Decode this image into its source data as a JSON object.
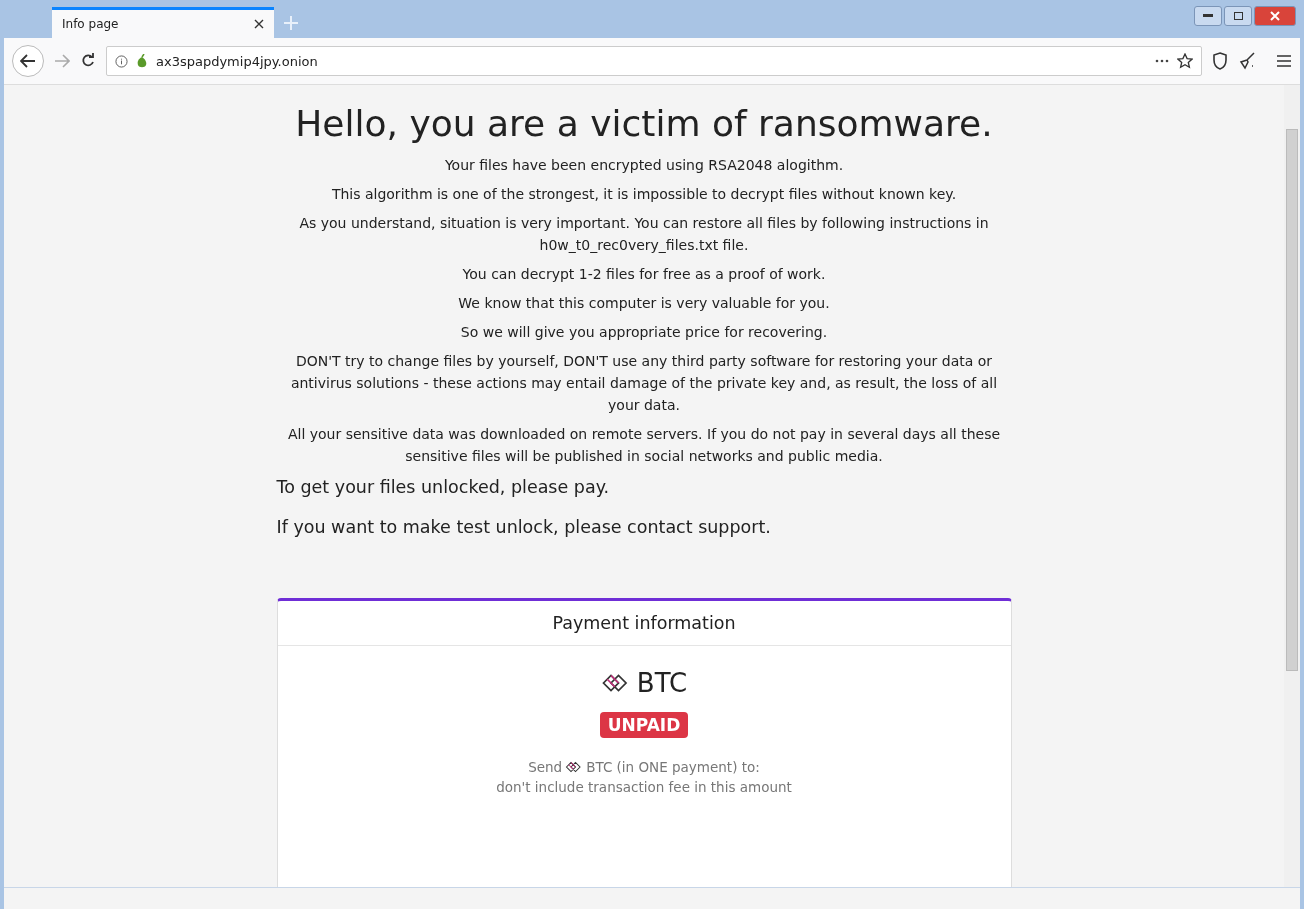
{
  "tabs": [
    {
      "title": "Info page",
      "selected": true
    }
  ],
  "address_bar": {
    "url": "ax3spapdymip4jpy.onion"
  },
  "page": {
    "heading": "Hello, you are a victim of ransomware.",
    "paragraphs": [
      "Your files have been encrypted using RSA2048 alogithm.",
      "This algorithm is one of the strongest, it is impossible to decrypt files without known key.",
      "As you understand, situation is very important. You can restore all files by following instructions in h0w_t0_rec0very_files.txt file.",
      "You can decrypt 1-2 files for free as a proof of work.",
      "We know that this computer is very valuable for you.",
      "So we will give you appropriate price for recovering.",
      "DON'T try to change files by yourself, DON'T use any third party software for restoring your data or antivirus solutions - these actions may entail damage of the private key and, as result, the loss of all your data.",
      "All your sensitive data was downloaded on remote servers. If you do not pay in several days all these sensitive files will be published in social networks and public media."
    ],
    "instructions": [
      "To get your files unlocked, please pay.",
      "If you want to make test unlock, please contact support."
    ],
    "payment": {
      "title": "Payment information",
      "currency": "BTC",
      "status": {
        "kind": "unpaid",
        "label": "UNPAID"
      },
      "send_prefix": "Send",
      "send_suffix": "BTC (in ONE payment) to:",
      "note": "don't include transaction fee in this amount"
    }
  }
}
